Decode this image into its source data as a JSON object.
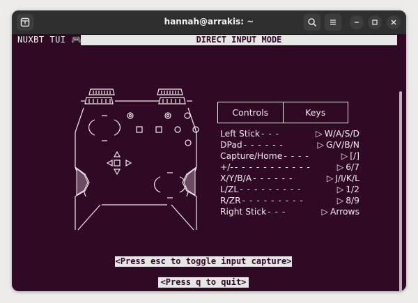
{
  "window": {
    "title": "hannah@arrakis: ~",
    "new_tab_icon": "new-tab-icon",
    "search_icon": "search-icon",
    "menu_icon": "hamburger-menu-icon",
    "minimize_icon": "minimize-icon",
    "maximize_icon": "maximize-icon",
    "close_icon": "close-icon"
  },
  "terminal": {
    "app_name": "NUXBT TUI 🎮",
    "mode": "DIRECT INPUT MODE",
    "controls_header": "Controls",
    "keys_header": "Keys",
    "bindings": [
      {
        "control": "Left Stick",
        "dashes": "- - -",
        "arrow": "▷",
        "key": "W/A/S/D"
      },
      {
        "control": "DPad",
        "dashes": "- - - - - -",
        "arrow": "▷",
        "key": "G/V/B/N"
      },
      {
        "control": "Capture/Home",
        "dashes": "- - - -",
        "arrow": "▷",
        "key": "[/]"
      },
      {
        "control": "+/-",
        "dashes": "- - - - - - - - - - -",
        "arrow": "▷",
        "key": "6/7"
      },
      {
        "control": "X/Y/B/A",
        "dashes": "- - - - - -",
        "arrow": "▷",
        "key": "J/I/K/L"
      },
      {
        "control": "L/ZL",
        "dashes": "- - - - - - - - -",
        "arrow": "▷",
        "key": "1/2"
      },
      {
        "control": "R/ZR",
        "dashes": "- - - - - - - - -",
        "arrow": "▷",
        "key": "8/9"
      },
      {
        "control": "Right Stick",
        "dashes": "- - -",
        "arrow": "▷",
        "key": "Arrows"
      }
    ],
    "hint_capture": "<Press esc to toggle input capture>",
    "hint_quit": "<Press q to quit>"
  },
  "colors": {
    "terminal_bg": "#300a24",
    "terminal_fg": "#f3ecef",
    "highlight_bg": "#e6e6e6",
    "titlebar_bg": "#2f2f2f",
    "trigger_fill": "#6b4a62"
  }
}
